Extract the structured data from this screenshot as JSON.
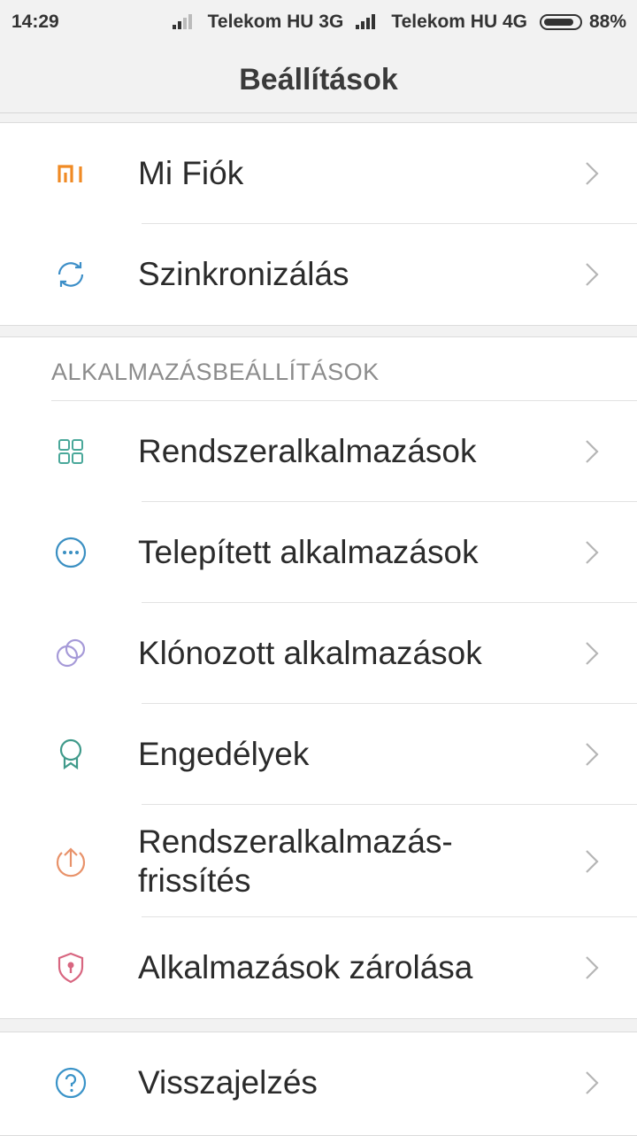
{
  "status_bar": {
    "time": "14:29",
    "carrier1": "Telekom HU 3G",
    "carrier2": "Telekom HU 4G",
    "battery": "88%",
    "battery_level": 0.88
  },
  "header": {
    "title": "Beállítások"
  },
  "account_group": {
    "items": [
      {
        "label": "Mi Fiók",
        "icon": "mi-logo-icon"
      },
      {
        "label": "Szinkronizálás",
        "icon": "sync-icon"
      }
    ]
  },
  "apps_group": {
    "section_title": "ALKALMAZÁSBEÁLLÍTÁSOK",
    "items": [
      {
        "label": "Rendszeralkalmazások",
        "icon": "grid-apps-icon"
      },
      {
        "label": "Telepített alkalmazások",
        "icon": "more-dots-icon"
      },
      {
        "label": "Klónozott alkalmazások",
        "icon": "dual-circles-icon"
      },
      {
        "label": "Engedélyek",
        "icon": "badge-ribbon-icon"
      },
      {
        "label": "Rendszeralkalmazás-frissítés",
        "icon": "upload-circle-icon"
      },
      {
        "label": "Alkalmazások zárolása",
        "icon": "shield-lock-icon"
      }
    ]
  },
  "feedback_group": {
    "items": [
      {
        "label": "Visszajelzés",
        "icon": "help-circle-icon"
      }
    ]
  },
  "colors": {
    "mi_orange": "#f08a24",
    "sync_blue": "#3d8fc8",
    "grid_green": "#4aa89a",
    "dots_blue": "#3a8fc2",
    "clone_purple": "#a69ad8",
    "badge_green": "#3f9a8a",
    "update_orange": "#e8926a",
    "lock_pink": "#d86680",
    "help_blue": "#3a93c8"
  }
}
